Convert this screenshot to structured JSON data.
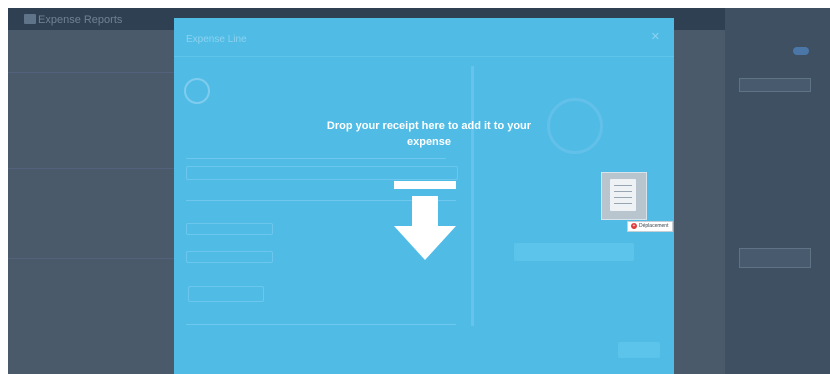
{
  "background_app": {
    "title": "Expense Reports"
  },
  "modal": {
    "title": "Expense Line",
    "close_icon": "close-icon"
  },
  "drop_zone": {
    "message": "Drop your receipt here to add it to your expense",
    "arrow_icon": "download-arrow-icon"
  },
  "drag_item": {
    "label": "Déplacement",
    "icon": "plus-icon"
  },
  "colors": {
    "overlay": "#50bce6",
    "drop_text": "#ffffff",
    "drag_badge": "#e03a3a"
  }
}
